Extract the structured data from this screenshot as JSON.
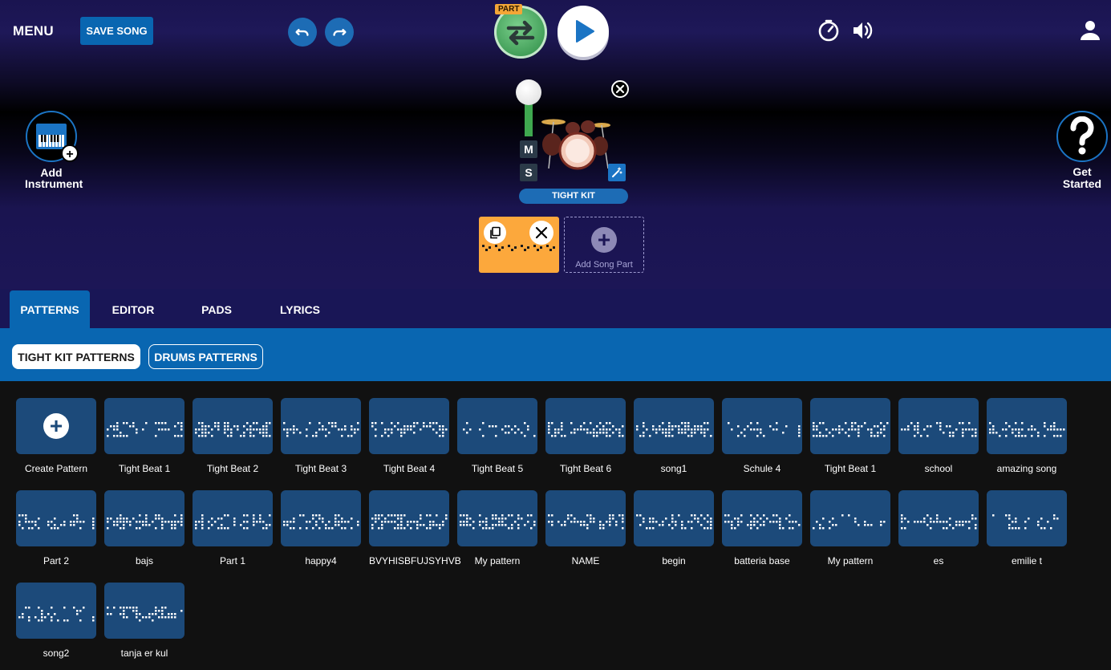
{
  "header": {
    "menu_label": "MENU",
    "save_label": "SAVE SONG",
    "part_tag": "PART"
  },
  "side": {
    "add_instrument_line1": "Add",
    "add_instrument_line2": "Instrument",
    "get_started_line1": "Get",
    "get_started_line2": "Started"
  },
  "instrument": {
    "name": "TIGHT KIT",
    "mute_label": "M",
    "solo_label": "S"
  },
  "song_parts": {
    "add_label": "Add Song Part"
  },
  "tabs": [
    "PATTERNS",
    "EDITOR",
    "PADS",
    "LYRICS"
  ],
  "active_tab": "PATTERNS",
  "pattern_sources": [
    "TIGHT KIT PATTERNS",
    "DRUMS PATTERNS"
  ],
  "active_source": "TIGHT KIT PATTERNS",
  "create_label": "Create Pattern",
  "patterns": [
    "Tight Beat 1",
    "Tight Beat 2",
    "Tight Beat 3",
    "Tight Beat 4",
    "Tight Beat 5",
    "Tight Beat 6",
    "song1",
    "Schule 4",
    "Tight Beat 1",
    "school",
    "amazing song",
    "Part 2",
    "bajs",
    "Part 1",
    "happy4",
    "BVYHISBFUJSYHVB",
    "My pattern",
    "NAME",
    "begin",
    "batteria base",
    "My pattern",
    "es",
    "emilie t",
    "song2",
    "tanja er kul"
  ],
  "colors": {
    "accent": "#0966b1",
    "tab_bar": "#191656",
    "tile": "#1c4a7a",
    "loop_green": "#3f9c56",
    "song_part": "#fca83c"
  }
}
